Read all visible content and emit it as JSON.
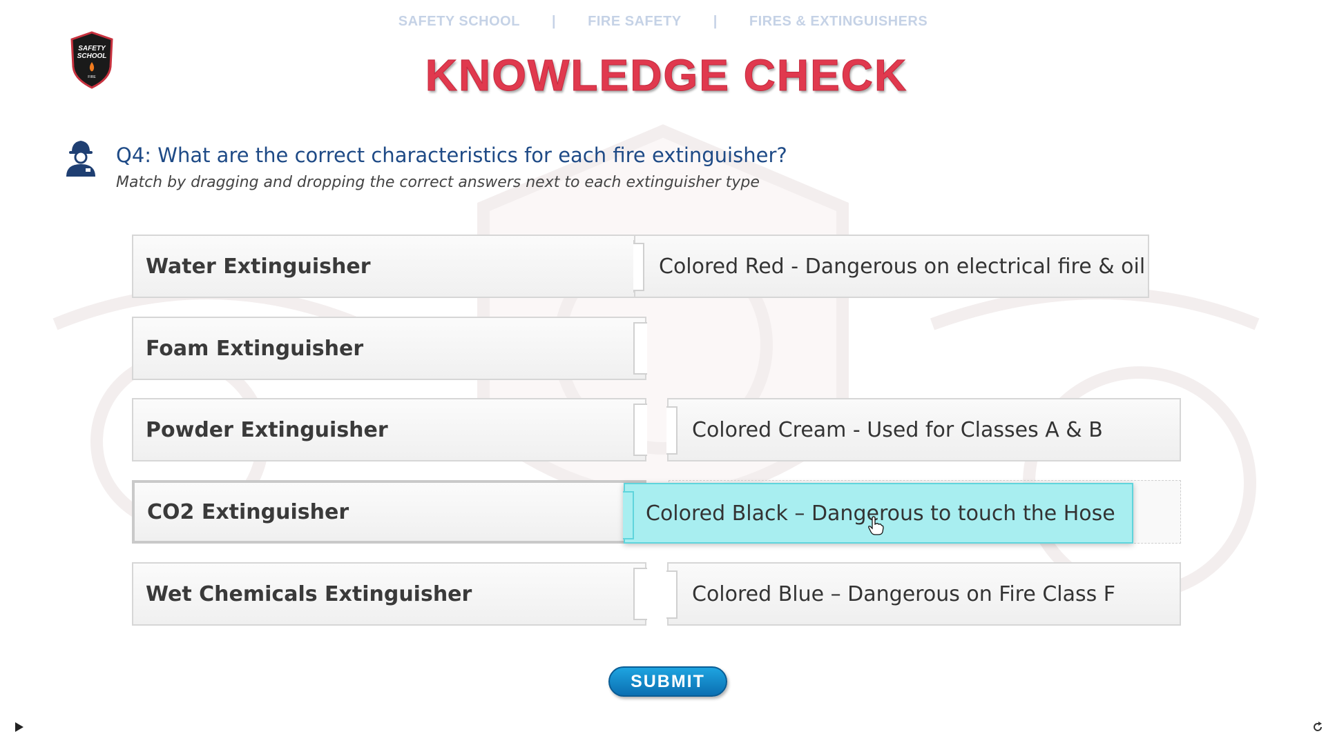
{
  "breadcrumb": {
    "items": [
      "SAFETY SCHOOL",
      "FIRE SAFETY",
      "FIRES & EXTINGUISHERS"
    ],
    "separator": "|"
  },
  "logo": {
    "text_line1": "SAFETY",
    "text_line2": "SCHOOL",
    "text_line3": "FIRE"
  },
  "title": "KNOWLEDGE CHECK",
  "question": {
    "text": "Q4: What are the correct characteristics for each fire extinguisher?",
    "instruction": "Match by dragging and dropping the correct answers next to each extinguisher type"
  },
  "rows": [
    {
      "label": "Water Extinguisher",
      "answer": "Colored Red - Dangerous on electrical fire & oil"
    },
    {
      "label": "Foam Extinguisher",
      "answer": ""
    },
    {
      "label": "Powder Extinguisher",
      "answer": "Colored Cream - Used for Classes A & B"
    },
    {
      "label": "CO2 Extinguisher",
      "answer": "Colored Black – Dangerous to touch the Hose"
    },
    {
      "label": "Wet Chemicals Extinguisher",
      "answer": "Colored Blue – Dangerous on Fire Class F"
    }
  ],
  "submit_label": "SUBMIT",
  "colors": {
    "title": "#e0394e",
    "question": "#1e4a86",
    "dragging_answer": "#a8eef0",
    "submit": "#0b6fb2"
  }
}
